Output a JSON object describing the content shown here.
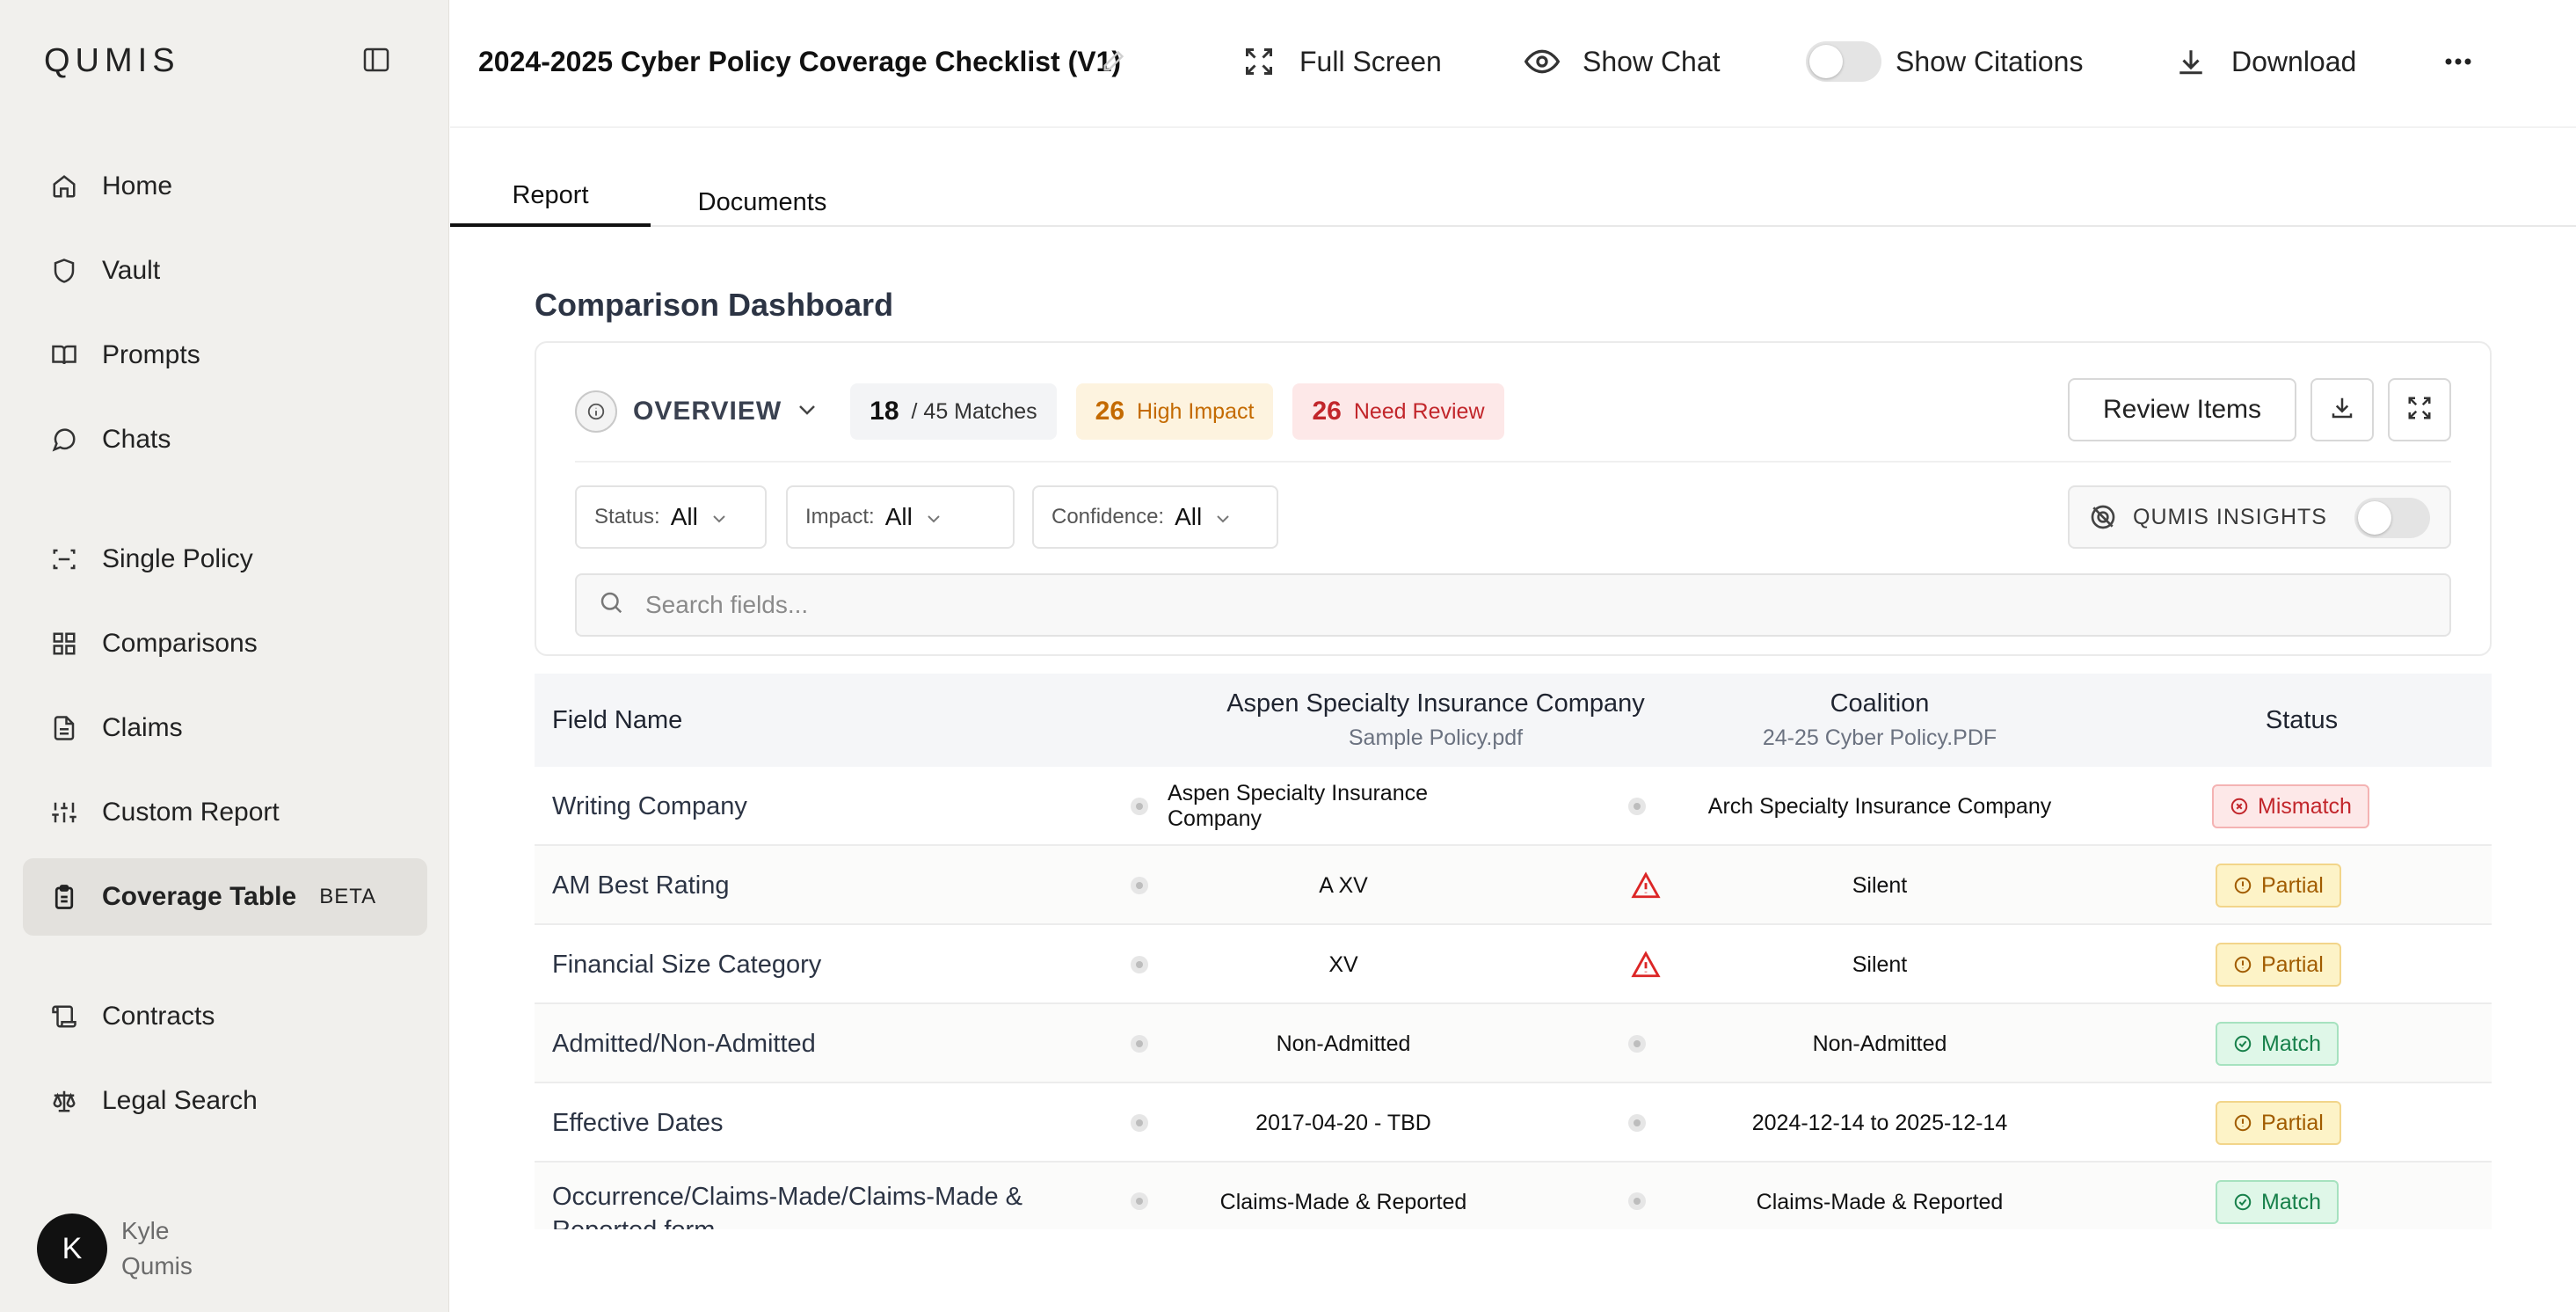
{
  "sidebar": {
    "logo": "QUMIS",
    "items": [
      {
        "label": "Home",
        "icon": "home-icon"
      },
      {
        "label": "Vault",
        "icon": "shield-icon"
      },
      {
        "label": "Prompts",
        "icon": "book-icon"
      },
      {
        "label": "Chats",
        "icon": "chat-icon"
      },
      {
        "label": "Single Policy",
        "icon": "scan-icon"
      },
      {
        "label": "Comparisons",
        "icon": "grid-icon"
      },
      {
        "label": "Claims",
        "icon": "file-icon"
      },
      {
        "label": "Custom Report",
        "icon": "sliders-icon"
      },
      {
        "label": "Coverage Table",
        "icon": "clipboard-icon",
        "badge": "BETA",
        "active": true
      },
      {
        "label": "Contracts",
        "icon": "scroll-icon"
      },
      {
        "label": "Legal Search",
        "icon": "scale-icon"
      }
    ],
    "user": {
      "initial": "K",
      "first": "Kyle",
      "last": "Qumis"
    }
  },
  "topbar": {
    "title": "2024-2025 Cyber Policy Coverage Checklist (V1)",
    "full_screen": "Full Screen",
    "show_chat": "Show Chat",
    "show_citations": "Show Citations",
    "download": "Download"
  },
  "tabs": {
    "report": "Report",
    "documents": "Documents"
  },
  "dashboard": {
    "title": "Comparison Dashboard",
    "overview": "OVERVIEW",
    "matches_count": "18",
    "matches_label": "/ 45 Matches",
    "high_impact_count": "26",
    "high_impact_label": "High Impact",
    "need_review_count": "26",
    "need_review_label": "Need Review",
    "review_items": "Review Items",
    "filters": {
      "status_label": "Status:",
      "status_value": "All",
      "impact_label": "Impact:",
      "impact_value": "All",
      "confidence_label": "Confidence:",
      "confidence_value": "All"
    },
    "insights_label": "QUMIS INSIGHTS",
    "search_placeholder": "Search fields..."
  },
  "table": {
    "col_field": "Field Name",
    "col_a_title": "Aspen Specialty Insurance Company",
    "col_a_file": "Sample Policy.pdf",
    "col_b_title": "Coalition",
    "col_b_file": "24-25 Cyber Policy.PDF",
    "col_status": "Status",
    "rows": [
      {
        "field": "Writing Company",
        "a": "Aspen Specialty Insurance Company",
        "b": "Arch Specialty Insurance Company",
        "b_warn": false,
        "status": "Mismatch"
      },
      {
        "field": "AM Best Rating",
        "a": "A XV",
        "b": "Silent",
        "b_warn": true,
        "status": "Partial"
      },
      {
        "field": "Financial Size Category",
        "a": "XV",
        "b": "Silent",
        "b_warn": true,
        "status": "Partial"
      },
      {
        "field": "Admitted/Non-Admitted",
        "a": "Non-Admitted",
        "b": "Non-Admitted",
        "b_warn": false,
        "status": "Match"
      },
      {
        "field": "Effective Dates",
        "a": "2017-04-20 - TBD",
        "b": "2024-12-14 to 2025-12-14",
        "b_warn": false,
        "status": "Partial"
      },
      {
        "field": "Occurrence/Claims-Made/Claims-Made & Reported form",
        "a": "Claims-Made & Reported",
        "b": "Claims-Made & Reported",
        "b_warn": false,
        "status": "Match"
      }
    ]
  },
  "colors": {
    "accent_red": "#c2262b",
    "accent_amber": "#c46a00",
    "accent_green": "#17804a",
    "sidebar_bg": "#f1f0ed"
  }
}
